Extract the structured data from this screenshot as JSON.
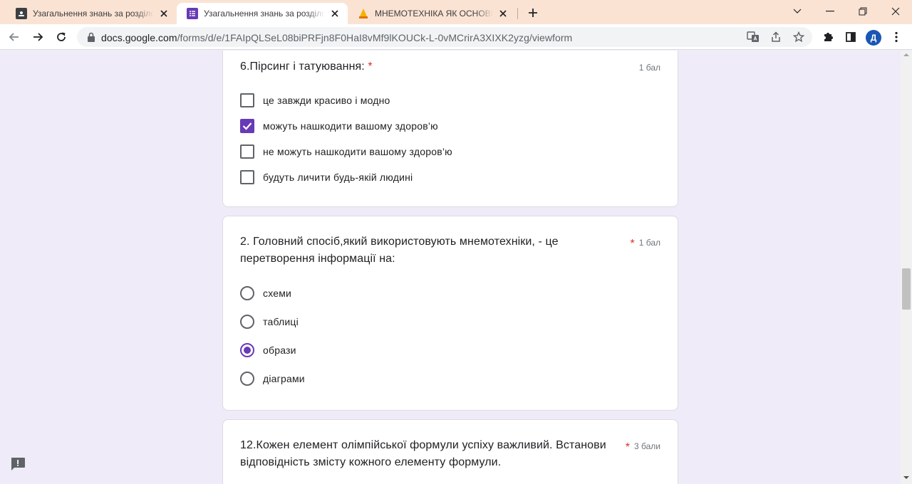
{
  "browser": {
    "tabs": [
      {
        "title": "Узагальнення знань за розділом"
      },
      {
        "title": "Узагальнення знань за розділом"
      },
      {
        "title": "МНЕМОТЕХНІКА ЯК ОСНОВНИЙ"
      }
    ],
    "url_host": "docs.google.com",
    "url_path": "/forms/d/e/1FAIpQLSeL08biPRFjn8F0HaI8vMf9lKOUCk-L-0vMCrirA3XIXK2yzg/viewform",
    "profile_initial": "Д",
    "colors": {
      "tabbar": "#fbe3d4",
      "accent": "#673ab7",
      "required": "#d93025",
      "avatar": "#1a57b4"
    }
  },
  "form": {
    "questions": [
      {
        "title": "6.Пірсинг і татуювання:",
        "required_mark": "*",
        "points": "1 бал",
        "type": "checkbox",
        "options": [
          {
            "label": "це завжди красиво і модно",
            "checked": false
          },
          {
            "label": "можуть нашкодити вашому здоров’ю",
            "checked": true
          },
          {
            "label": "не можуть нашкодити вашому здоров’ю",
            "checked": false
          },
          {
            "label": "будуть личити будь-якій людині",
            "checked": false
          }
        ]
      },
      {
        "title": "2. Головний спосіб,який використовують мнемотехніки, - це перетворення інформації на:",
        "required_mark": "*",
        "points": "1 бал",
        "type": "radio",
        "options": [
          {
            "label": "схеми",
            "checked": false
          },
          {
            "label": "таблиці",
            "checked": false
          },
          {
            "label": "образи",
            "checked": true
          },
          {
            "label": "діаграми",
            "checked": false
          }
        ]
      },
      {
        "title": "12.Кожен елемент олімпійської формули успіху важливий. Встанови відповідність змісту кожного елементу формули.",
        "required_mark": "*",
        "points": "3 бали",
        "type": "grid"
      }
    ]
  }
}
